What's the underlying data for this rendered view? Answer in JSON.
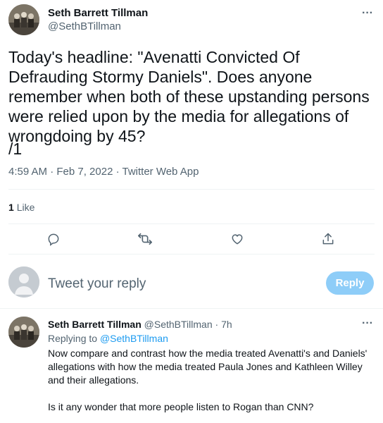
{
  "main_tweet": {
    "author_name": "Seth Barrett Tillman",
    "author_handle": "@SethBTillman",
    "text": "Today's headline: \"Avenatti Convicted Of Defrauding Stormy Daniels\". Does anyone remember when both of these upstanding persons were relied upon by the media for allegations of wrongdoing by 45?",
    "text_suffix": "/1",
    "timestamp": "4:59 AM · Feb 7, 2022 · Twitter Web App",
    "like_count": "1",
    "like_label": "Like",
    "more_icon": "more-horizontal-icon"
  },
  "actions": {
    "reply_icon": "reply-icon",
    "retweet_icon": "retweet-icon",
    "like_icon": "heart-icon",
    "share_icon": "share-icon"
  },
  "compose": {
    "placeholder": "Tweet your reply",
    "button_label": "Reply",
    "button_color": "#8ecdf8"
  },
  "reply_tweet": {
    "author_name": "Seth Barrett Tillman",
    "author_handle": "@SethBTillman",
    "separator": "·",
    "time_ago": "7h",
    "replying_to_label": "Replying to",
    "replying_to_handle": "@SethBTillman",
    "text": "Now compare and contrast how the media treated Avenatti's and Daniels' allegations with how the media treated Paula Jones and Kathleen Willey and their allegations.",
    "text2": "Is it any wonder that more people listen to Rogan than CNN?"
  },
  "colors": {
    "accent": "#1d9bf0",
    "secondary_text": "#536471",
    "primary_text": "#0f1419"
  }
}
